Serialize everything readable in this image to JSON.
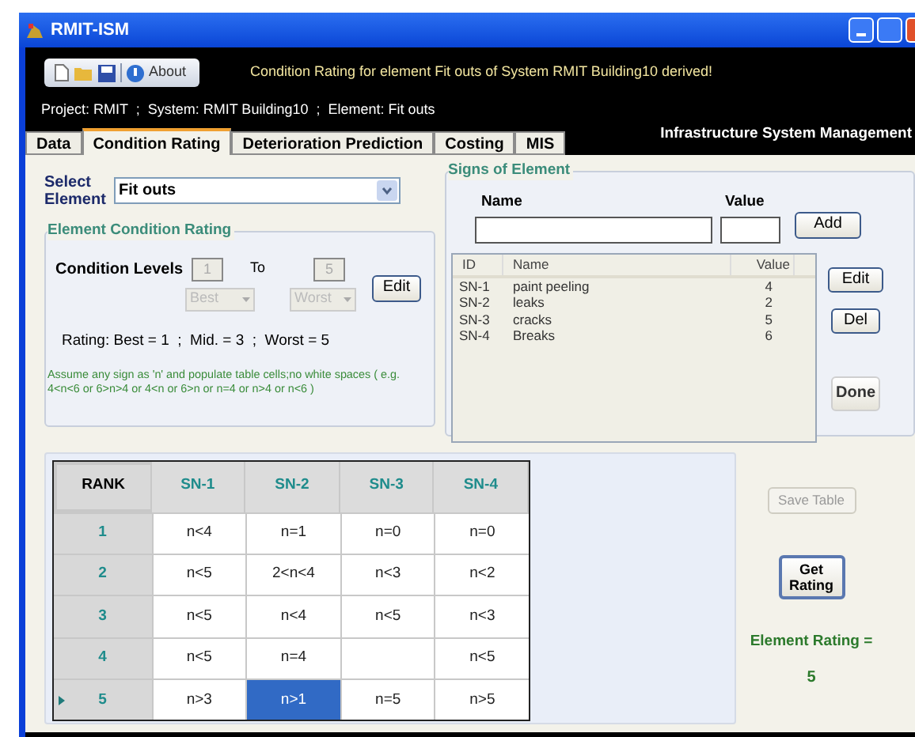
{
  "window": {
    "title": "RMIT-ISM"
  },
  "toolbar": {
    "about": "About"
  },
  "message": "Condition Rating for element Fit outs of System RMIT Building10 derived!",
  "context_line": "Project: RMIT  ;  System: RMIT Building10  ;  Element: Fit outs",
  "tabs": [
    {
      "label": "Data",
      "selected": false
    },
    {
      "label": "Condition Rating",
      "selected": true
    },
    {
      "label": "Deterioration Prediction",
      "selected": false
    },
    {
      "label": "Costing",
      "selected": false
    },
    {
      "label": "MIS",
      "selected": false
    }
  ],
  "app_title": "Infrastructure System Management",
  "select_element": {
    "label": "Select Element",
    "value": "Fit outs"
  },
  "condition_rating": {
    "title": "Element Condition Rating",
    "levels_label": "Condition Levels",
    "from": "1",
    "to_label": "To",
    "to": "5",
    "best": "Best",
    "worst": "Worst",
    "disabled": true,
    "edit": "Edit",
    "rating_line": "Rating: Best = 1  ;  Mid. = 3  ;  Worst = 5",
    "hint": "Assume any sign as 'n' and populate table cells;no white spaces ( e.g. 4<n<6 or 6>n>4 or 4<n or 6>n or n=4 or n>4 or n<6 )"
  },
  "signs": {
    "title": "Signs of Element",
    "name_label": "Name",
    "value_label": "Value",
    "add": "Add",
    "columns": [
      "ID",
      "Name",
      "Value"
    ],
    "rows": [
      [
        "SN-1",
        "paint peeling",
        "4"
      ],
      [
        "SN-2",
        "leaks",
        "2"
      ],
      [
        "SN-3",
        "cracks",
        "5"
      ],
      [
        "SN-4",
        "Breaks",
        "6"
      ]
    ],
    "edit": "Edit",
    "del": "Del",
    "done": "Done"
  },
  "rating_table": {
    "columns": [
      "RANK",
      "SN-1",
      "SN-2",
      "SN-3",
      "SN-4"
    ],
    "rows": [
      {
        "current": false,
        "cells": [
          {
            "text": "1",
            "selected": false
          },
          {
            "text": "n<4",
            "selected": false
          },
          {
            "text": "n=1",
            "selected": false
          },
          {
            "text": "n=0",
            "selected": false
          },
          {
            "text": "n=0",
            "selected": false
          }
        ]
      },
      {
        "current": false,
        "cells": [
          {
            "text": "2",
            "selected": false
          },
          {
            "text": "n<5",
            "selected": false
          },
          {
            "text": "2<n<4",
            "selected": false
          },
          {
            "text": "n<3",
            "selected": false
          },
          {
            "text": "n<2",
            "selected": false
          }
        ]
      },
      {
        "current": false,
        "cells": [
          {
            "text": "3",
            "selected": false
          },
          {
            "text": "n<5",
            "selected": false
          },
          {
            "text": "n<4",
            "selected": false
          },
          {
            "text": "n<5",
            "selected": false
          },
          {
            "text": "n<3",
            "selected": false
          }
        ]
      },
      {
        "current": false,
        "cells": [
          {
            "text": "4",
            "selected": false
          },
          {
            "text": "n<5",
            "selected": false
          },
          {
            "text": "n=4",
            "selected": false
          },
          {
            "selected": false
          },
          {
            "text": "n<5",
            "selected": false
          }
        ]
      },
      {
        "current": true,
        "cells": [
          {
            "text": "5",
            "selected": false
          },
          {
            "text": "n>3",
            "selected": false
          },
          {
            "text": "n>1",
            "selected": true
          },
          {
            "text": "n=5",
            "selected": false
          },
          {
            "text": "n>5",
            "selected": false
          }
        ]
      }
    ]
  },
  "save_table": {
    "label": "Save Table",
    "disabled": true
  },
  "get_rating": "Get Rating",
  "element_rating": {
    "label": "Element Rating =",
    "value": "5"
  }
}
